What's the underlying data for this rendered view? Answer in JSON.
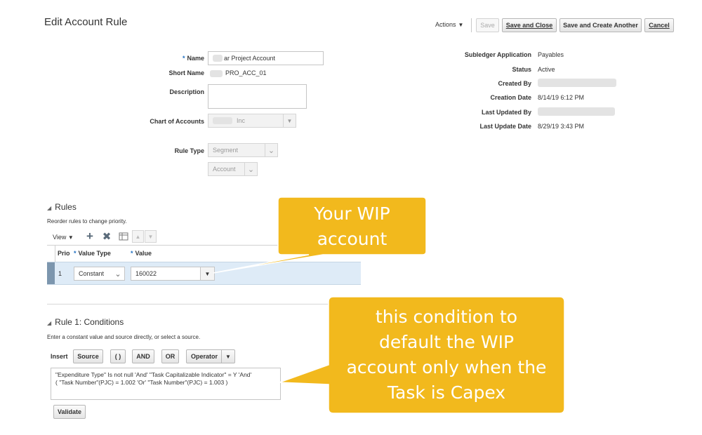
{
  "page": {
    "title": "Edit Account Rule"
  },
  "toolbar": {
    "actions_label": "Actions",
    "save_label": "Save",
    "save_close_label": "Save and Close",
    "save_create_label": "Save and Create Another",
    "cancel_label": "Cancel"
  },
  "form": {
    "name_label": "Name",
    "name_value": "ar Project Account",
    "short_name_label": "Short Name",
    "short_name_value": "PRO_ACC_01",
    "description_label": "Description",
    "description_value": "",
    "coa_label": "Chart of Accounts",
    "coa_value": "Inc",
    "rule_type_label": "Rule Type",
    "rule_type_value": "Segment",
    "segment_value": "Account"
  },
  "info": {
    "subledger_label": "Subledger Application",
    "subledger_value": "Payables",
    "status_label": "Status",
    "status_value": "Active",
    "created_by_label": "Created By",
    "creation_date_label": "Creation Date",
    "creation_date_value": "8/14/19 6:12 PM",
    "last_updated_by_label": "Last Updated By",
    "last_update_date_label": "Last Update Date",
    "last_update_date_value": "8/29/19 3:43 PM"
  },
  "rules": {
    "title": "Rules",
    "hint": "Reorder rules to change priority.",
    "view_label": "View",
    "columns": {
      "prio": "Prio",
      "value_type": "Value Type",
      "value": "Value"
    },
    "rows": [
      {
        "prio": "1",
        "value_type": "Constant",
        "value": "160022"
      }
    ]
  },
  "conditions": {
    "title": "Rule 1: Conditions",
    "hint": "Enter a constant value and source directly, or select a source.",
    "insert_label": "Insert",
    "source_label": "Source",
    "paren_label": "( )",
    "and_label": "AND",
    "or_label": "OR",
    "operator_label": "Operator",
    "expression_line1": "\"Expenditure Type\" Is not null 'And' \"Task Capitalizable Indicator\" = Y 'And'",
    "expression_line2": "( \"Task Number\"(PJC) = 1.002 'Or' \"Task Number\"(PJC) = 1.003 )",
    "validate_label": "Validate"
  },
  "callouts": {
    "wip_line1": "Your WIP",
    "wip_line2": "account",
    "cond_line1": "this condition to",
    "cond_line2": "default the WIP",
    "cond_line3": "account  only when the",
    "cond_line4": "Task is Capex"
  },
  "colors": {
    "callout": "#f2b91d",
    "selected_row": "#deebf7",
    "required": "#1f6fc1"
  },
  "icons": [
    "dropdown-caret-icon",
    "add-icon",
    "delete-icon",
    "freeze-icon",
    "move-up-icon",
    "move-down-icon",
    "collapse-triangle-icon"
  ]
}
